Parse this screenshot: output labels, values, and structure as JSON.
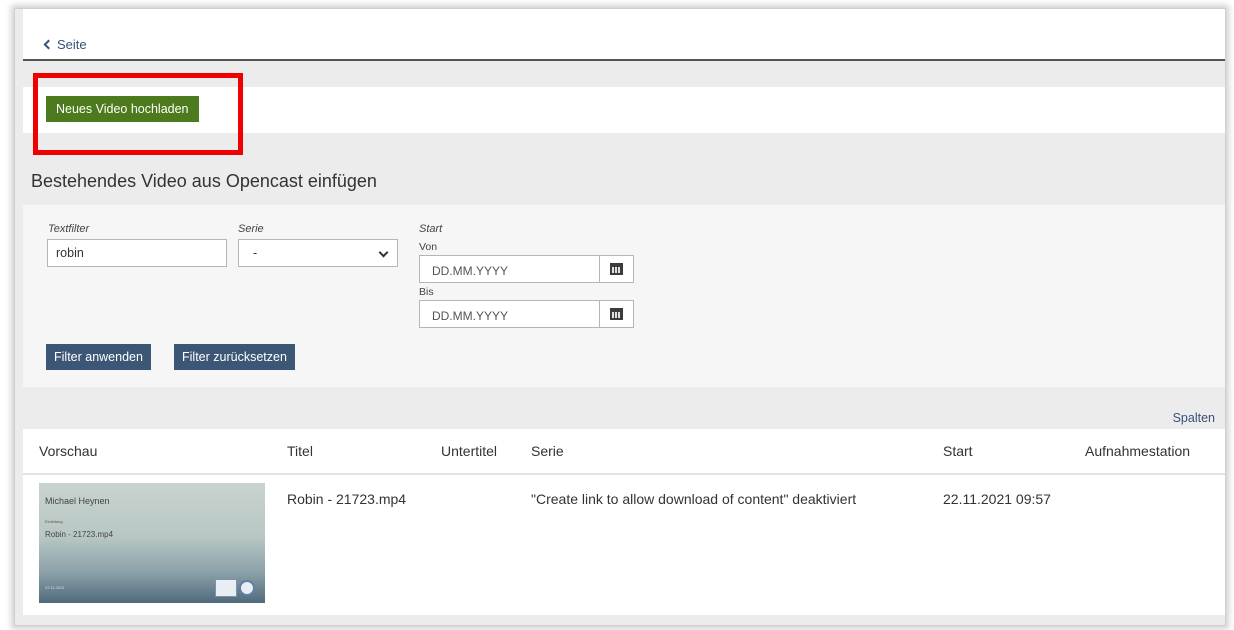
{
  "nav": {
    "back_label": "Seite"
  },
  "upload": {
    "button_label": "Neues Video hochladen"
  },
  "section": {
    "title": "Bestehendes Video aus Opencast einfügen"
  },
  "filters": {
    "textfilter_label": "Textfilter",
    "textfilter_value": "robin",
    "serie_label": "Serie",
    "serie_value": "-",
    "start_label": "Start",
    "from_label": "Von",
    "from_placeholder": "DD.MM.YYYY",
    "to_label": "Bis",
    "to_placeholder": "DD.MM.YYYY",
    "apply_label": "Filter anwenden",
    "reset_label": "Filter zurücksetzen"
  },
  "table": {
    "columns_link": "Spalten",
    "headers": [
      "Vorschau",
      "Titel",
      "Untertitel",
      "Serie",
      "Start",
      "Aufnahmestation"
    ],
    "rows": [
      {
        "preview": {
          "author": "Michael Heynen",
          "small": "Einleitung",
          "title": "Robin - 21723.mp4",
          "date": "22.11.2021"
        },
        "title": "Robin - 21723.mp4",
        "subtitle": "",
        "series": "\"Create link to allow download of content\" deaktiviert",
        "start": "22.11.2021 09:57",
        "station": ""
      }
    ]
  },
  "colors": {
    "upload_button": "#4c7a1c",
    "filter_button": "#3b5775",
    "highlight": "#f00000",
    "link": "#3a5078"
  }
}
